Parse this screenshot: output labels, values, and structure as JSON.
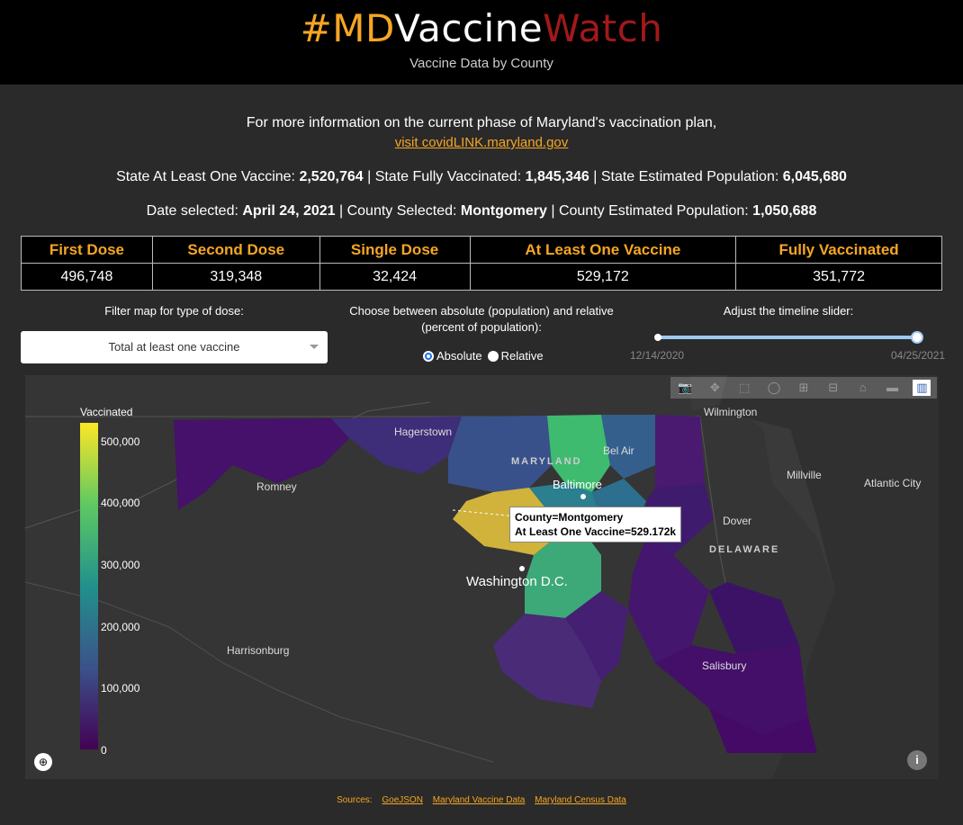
{
  "header": {
    "title_part1": "#MD",
    "title_part2": "Vaccine",
    "title_part3": "Watch",
    "subtitle": "Vaccine Data by County",
    "colors": {
      "orange": "#f6a623",
      "white": "#ffffff",
      "red": "#a0191c"
    }
  },
  "info": {
    "line": "For more information on the current phase of Maryland's vaccination plan,",
    "link": "visit covidLINK.maryland.gov"
  },
  "state_stats": {
    "label1": "State At Least One Vaccine: ",
    "value1": "2,520,764",
    "label2": " | State Fully Vaccinated: ",
    "value2": "1,845,346",
    "label3": " | State Estimated Population: ",
    "value3": "6,045,680"
  },
  "selection": {
    "label1": "Date selected: ",
    "value1": "April 24, 2021",
    "label2": " | County Selected: ",
    "value2": "Montgomery",
    "label3": " | County Estimated Population: ",
    "value3": "1,050,688"
  },
  "table": {
    "headers": [
      "First Dose",
      "Second Dose",
      "Single Dose",
      "At Least One Vaccine",
      "Fully Vaccinated"
    ],
    "values": [
      "496,748",
      "319,348",
      "32,424",
      "529,172",
      "351,772"
    ]
  },
  "controls": {
    "filter_label": "Filter map for type of dose:",
    "filter_value": "Total at least one vaccine",
    "mode_label_1": "Choose between absolute (population) and relative",
    "mode_label_2": "(percent of population):",
    "mode_absolute": "Absolute",
    "mode_relative": "Relative",
    "mode_selected": "Absolute",
    "slider_label": "Adjust the timeline slider:",
    "slider_start": "12/14/2020",
    "slider_end": "04/25/2021",
    "slider_position": 1.0
  },
  "map": {
    "colorbar_title": "Vaccinated",
    "colorbar_ticks": [
      "500,000",
      "400,000",
      "300,000",
      "200,000",
      "100,000",
      "0"
    ],
    "places": {
      "wilmington": "Wilmington",
      "hagerstown": "Hagerstown",
      "bel_air": "Bel Air",
      "millville": "Millville",
      "atlantic_city": "Atlantic City",
      "maryland": "MARYLAND",
      "baltimore": "Baltimore",
      "romney": "Romney",
      "dover": "Dover",
      "delaware": "DELAWARE",
      "washington": "Washington D.C.",
      "harrisonburg": "Harrisonburg",
      "salisbury": "Salisbury"
    },
    "tooltip_line1": "County=Montgomery",
    "tooltip_line2": "At Least One Vaccine=529.172k",
    "modebar_icons": [
      "camera-icon",
      "pan-icon",
      "box-select-icon",
      "lasso-icon",
      "zoom-in-icon",
      "zoom-out-icon",
      "home-icon",
      "eraser-icon",
      "plotly-logo-icon"
    ]
  },
  "footer": {
    "sources_label": "Sources:",
    "link1": "GoeJSON",
    "link2": "Maryland Vaccine Data",
    "link3": "Maryland Census Data"
  }
}
